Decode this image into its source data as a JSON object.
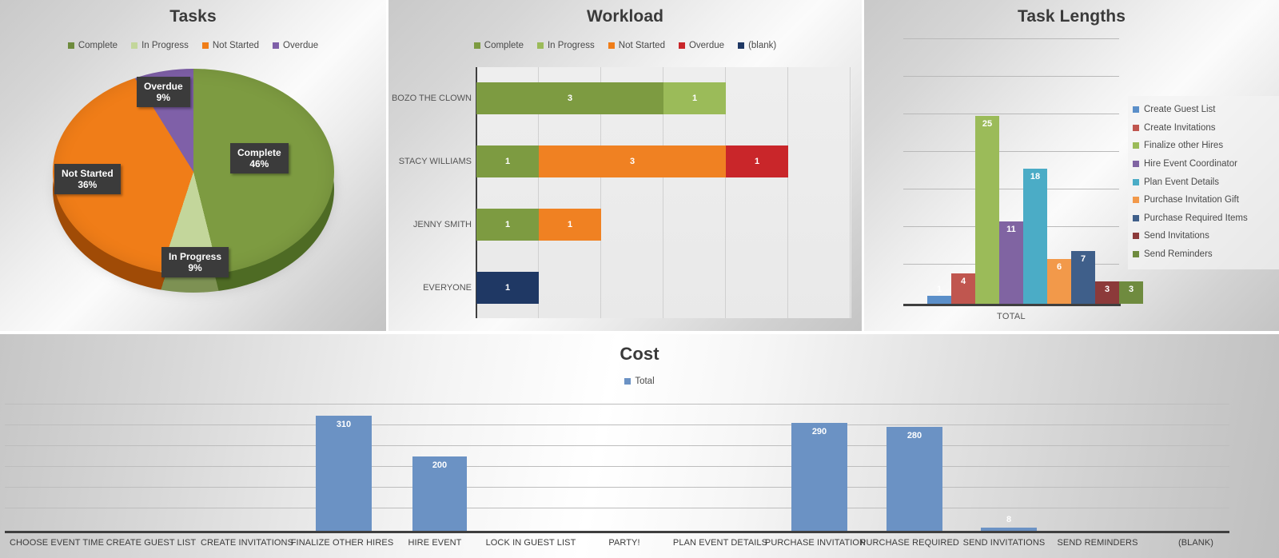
{
  "panels": {
    "tasks": {
      "title": "Tasks"
    },
    "workload": {
      "title": "Workload"
    },
    "task_lengths": {
      "title": "Task Lengths"
    },
    "cost": {
      "title": "Cost"
    }
  },
  "colors": {
    "complete": "#7d9b41",
    "in_progress": "#c3d69b",
    "not_started": "#f07d18",
    "overdue_pie": "#7f60a8",
    "overdue_bar": "#c9262a",
    "blank": "#1f3864",
    "cost_total": "#6b92c4",
    "series_blue": "#5b8fc9",
    "series_red": "#c0564f",
    "series_green": "#9bbb59",
    "series_purple": "#8064a2",
    "series_cyan": "#4bacc6",
    "series_orange": "#f2994a",
    "series_navy": "#3f5f8a",
    "series_darkred": "#8c3a3a",
    "series_darkgreen": "#6f8b3f"
  },
  "chart_data": [
    {
      "type": "pie",
      "title": "Tasks",
      "legend_position": "top",
      "categories": [
        "Complete",
        "In Progress",
        "Not Started",
        "Overdue"
      ],
      "values": [
        46,
        9,
        36,
        9
      ],
      "value_unit": "%",
      "labels": [
        {
          "name": "Complete",
          "pct": "46%"
        },
        {
          "name": "In Progress",
          "pct": "9%"
        },
        {
          "name": "Not Started",
          "pct": "36%"
        },
        {
          "name": "Overdue",
          "pct": "9%"
        }
      ]
    },
    {
      "type": "bar",
      "orientation": "horizontal",
      "stacked": true,
      "title": "Workload",
      "legend_position": "top",
      "legend": [
        "Complete",
        "In Progress",
        "Not Started",
        "Overdue",
        "(blank)"
      ],
      "categories": [
        "BOZO THE CLOWN",
        "STACY WILLIAMS",
        "JENNY SMITH",
        "EVERYONE"
      ],
      "xlabel": "",
      "ylabel": "",
      "xlim": [
        0,
        6
      ],
      "grid": true,
      "series": [
        {
          "name": "Complete",
          "values": [
            3,
            1,
            1,
            0
          ]
        },
        {
          "name": "In Progress",
          "values": [
            1,
            0,
            0,
            0
          ]
        },
        {
          "name": "Not Started",
          "values": [
            0,
            3,
            1,
            0
          ]
        },
        {
          "name": "Overdue",
          "values": [
            0,
            1,
            0,
            0
          ]
        },
        {
          "name": "(blank)",
          "values": [
            0,
            0,
            0,
            1
          ]
        }
      ],
      "bar_labels": [
        [
          {
            "series": "Complete",
            "value": "3"
          },
          {
            "series": "In Progress",
            "value": "1"
          }
        ],
        [
          {
            "series": "Complete",
            "value": "1"
          },
          {
            "series": "Not Started",
            "value": "3"
          },
          {
            "series": "Overdue",
            "value": "1"
          }
        ],
        [
          {
            "series": "Complete",
            "value": "1"
          },
          {
            "series": "Not Started",
            "value": "1"
          }
        ],
        [
          {
            "series": "(blank)",
            "value": "1"
          }
        ]
      ]
    },
    {
      "type": "bar",
      "orientation": "vertical",
      "title": "Task Lengths",
      "legend_position": "right",
      "categories": [
        "TOTAL"
      ],
      "xlabel": "TOTAL",
      "ylabel": "",
      "ylim": [
        0,
        35
      ],
      "grid": true,
      "series": [
        {
          "name": "Create Guest List",
          "values": [
            1
          ]
        },
        {
          "name": "Create Invitations",
          "values": [
            4
          ]
        },
        {
          "name": "Finalize other Hires",
          "values": [
            25
          ]
        },
        {
          "name": "Hire Event Coordinator",
          "values": [
            11
          ]
        },
        {
          "name": "Plan Event Details",
          "values": [
            18
          ]
        },
        {
          "name": "Purchase Invitation Gift",
          "values": [
            6
          ]
        },
        {
          "name": "Purchase Required Items",
          "values": [
            7
          ]
        },
        {
          "name": "Send Invitations",
          "values": [
            3
          ]
        },
        {
          "name": "Send Reminders",
          "values": [
            3
          ]
        }
      ]
    },
    {
      "type": "bar",
      "orientation": "vertical",
      "title": "Cost",
      "legend_position": "top",
      "legend": [
        "Total"
      ],
      "categories": [
        "CHOOSE EVENT TIME",
        "CREATE GUEST LIST",
        "CREATE INVITATIONS",
        "FINALIZE OTHER HIRES",
        "HIRE EVENT",
        "LOCK IN GUEST LIST",
        "PARTY!",
        "PLAN EVENT DETAILS",
        "PURCHASE INVITATION",
        "PURCHASE REQUIRED",
        "SEND INVITATIONS",
        "SEND REMINDERS",
        "(BLANK)"
      ],
      "xlabel": "",
      "ylabel": "",
      "ylim": [
        0,
        350
      ],
      "grid": true,
      "series": [
        {
          "name": "Total",
          "values": [
            0,
            0,
            0,
            310,
            200,
            0,
            0,
            0,
            290,
            280,
            8,
            0,
            0
          ]
        }
      ],
      "bar_labels": [
        "",
        "",
        "",
        "310",
        "200",
        "",
        "",
        "",
        "290",
        "280",
        "8",
        "",
        ""
      ]
    }
  ]
}
